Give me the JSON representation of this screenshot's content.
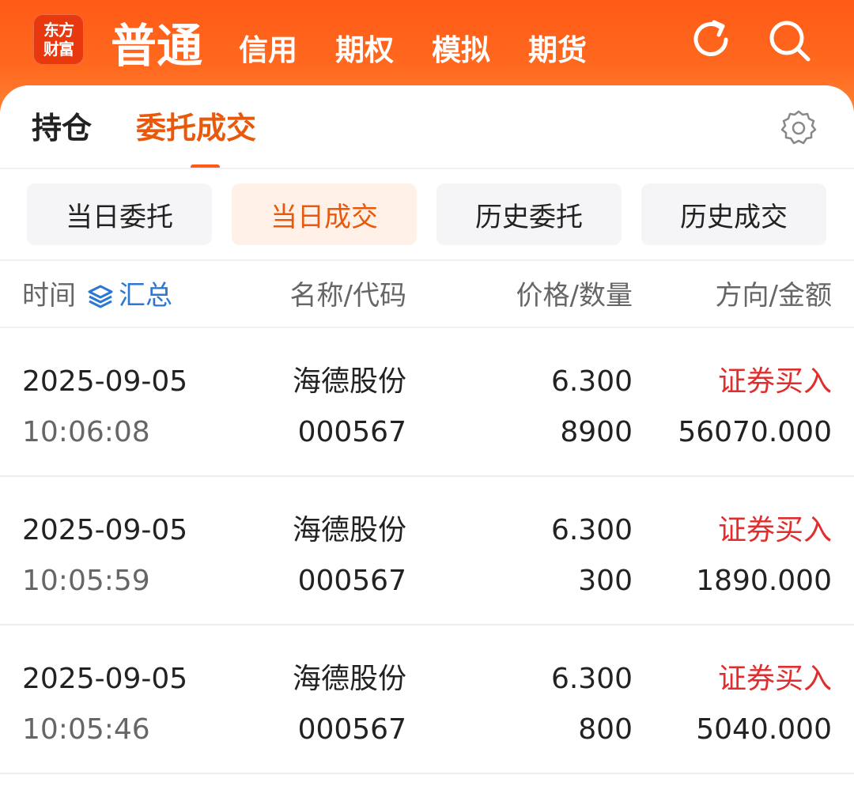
{
  "logo": {
    "line1": "东方",
    "line2": "财富"
  },
  "mode_tabs": [
    "普通",
    "信用",
    "期权",
    "模拟",
    "期货"
  ],
  "icons": {
    "refresh": "refresh-icon",
    "search": "search-icon",
    "settings": "gear-icon",
    "summary": "layers-icon"
  },
  "sub_tabs": [
    "持仓",
    "委托成交"
  ],
  "filters": [
    "当日委托",
    "当日成交",
    "历史委托",
    "历史成交"
  ],
  "columns": {
    "time": "时间",
    "summary": "汇总",
    "name_code": "名称/代码",
    "price_qty": "价格/数量",
    "dir_amount": "方向/金额"
  },
  "trades": [
    {
      "date": "2025-09-05",
      "time": "10:06:08",
      "name": "海德股份",
      "code": "000567",
      "price": "6.300",
      "quantity": "8900",
      "direction": "证券买入",
      "amount": "56070.000"
    },
    {
      "date": "2025-09-05",
      "time": "10:05:59",
      "name": "海德股份",
      "code": "000567",
      "price": "6.300",
      "quantity": "300",
      "direction": "证券买入",
      "amount": "1890.000"
    },
    {
      "date": "2025-09-05",
      "time": "10:05:46",
      "name": "海德股份",
      "code": "000567",
      "price": "6.300",
      "quantity": "800",
      "direction": "证券买入",
      "amount": "5040.000"
    }
  ],
  "colors": {
    "accent": "#ff5a16",
    "buy": "#e02e2e",
    "link": "#2c77d6"
  }
}
